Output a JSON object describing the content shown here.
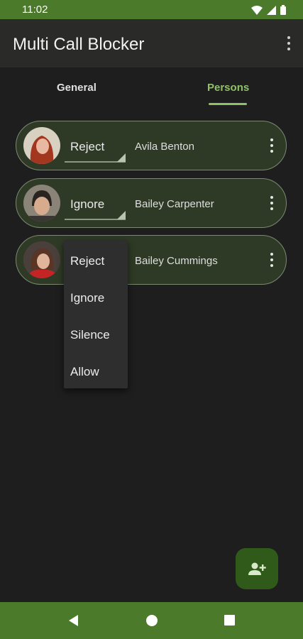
{
  "status_bar": {
    "time": "11:02",
    "icons": [
      "wifi-icon",
      "signal-icon",
      "battery-icon"
    ]
  },
  "app_bar": {
    "title": "Multi Call Blocker",
    "menu_icon": "more-vert-icon"
  },
  "tabs": [
    {
      "label": "General",
      "selected": false
    },
    {
      "label": "Persons",
      "selected": true
    }
  ],
  "persons": [
    {
      "action": "Reject",
      "name": "Avila Benton"
    },
    {
      "action": "Ignore",
      "name": "Bailey Carpenter"
    },
    {
      "action": "",
      "name": "Bailey Cummings"
    }
  ],
  "dropdown": {
    "options": [
      "Reject",
      "Ignore",
      "Silence",
      "Allow"
    ]
  },
  "fab": {
    "icon": "add-person-icon"
  },
  "nav_bar": {
    "icons": [
      "back-icon",
      "home-icon",
      "recents-icon"
    ]
  },
  "colors": {
    "accent": "#8fc266",
    "status_bar": "#4a7a2a",
    "card_bg": "#2f3a26",
    "fab_bg": "#2f5a1a"
  }
}
